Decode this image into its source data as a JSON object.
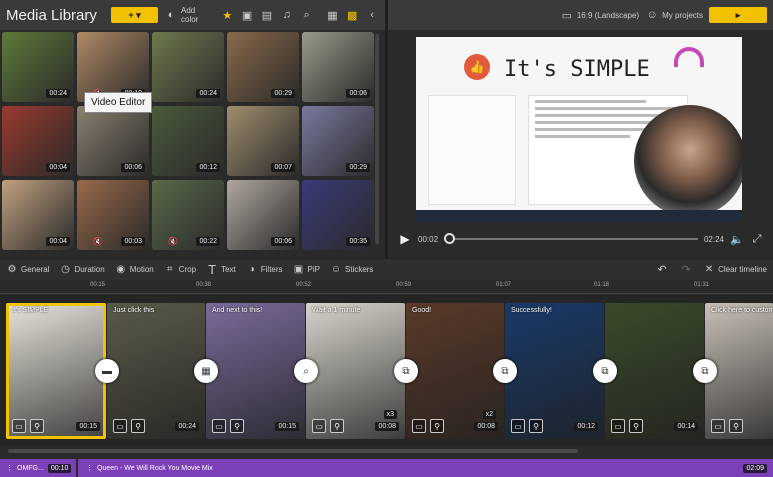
{
  "header": {
    "title": "Media Library",
    "add_color_label": "Add color",
    "aspect_label": "16:9 (Landscape)",
    "my_projects_label": "My projects"
  },
  "tooltip": "Video Editor",
  "media": [
    {
      "duration": "00:24",
      "muted": false,
      "color": "#5f7a3a"
    },
    {
      "duration": "00:10",
      "muted": true,
      "color": "#b08a66"
    },
    {
      "duration": "00:24",
      "muted": false,
      "color": "#6e7a4e"
    },
    {
      "duration": "00:29",
      "muted": false,
      "color": "#8a6a4a"
    },
    {
      "duration": "00:06",
      "muted": false,
      "color": "#9a9a8a"
    },
    {
      "duration": "00:04",
      "muted": false,
      "color": "#9a3a2e"
    },
    {
      "duration": "00:06",
      "muted": false,
      "color": "#8a8070"
    },
    {
      "duration": "00:12",
      "muted": false,
      "color": "#4a5a3a"
    },
    {
      "duration": "00:07",
      "muted": false,
      "color": "#a08e6e"
    },
    {
      "duration": "00:29",
      "muted": false,
      "color": "#7a7aa0"
    },
    {
      "duration": "00:04",
      "muted": false,
      "color": "#c0a080"
    },
    {
      "duration": "00:03",
      "muted": true,
      "color": "#9a6a4a"
    },
    {
      "duration": "00:22",
      "muted": true,
      "color": "#5a6a4a"
    },
    {
      "duration": "00:06",
      "muted": false,
      "color": "#b0a8a0"
    },
    {
      "duration": "00:35",
      "muted": false,
      "color": "#3a3a7a"
    }
  ],
  "preview": {
    "title": "It's SIMPLE",
    "current_time": "00:02",
    "total_time": "02:24",
    "progress": 0.02
  },
  "toolbar": {
    "general": "General",
    "duration": "Duration",
    "motion": "Motion",
    "crop": "Crop",
    "text": "Text",
    "filters": "Filters",
    "pip": "PiP",
    "stickers": "Stickers",
    "clear_timeline": "Clear timeline"
  },
  "ruler": [
    "00:15",
    "00:38",
    "00:52",
    "00:59",
    "01:07",
    "01:18",
    "01:31"
  ],
  "clips": [
    {
      "caption": "It's SIMPLE",
      "duration": "00:15",
      "color": "#e8e4dc"
    },
    {
      "caption": "Just click this",
      "duration": "00:24",
      "color": "#5a5a4a"
    },
    {
      "caption": "And next to this!",
      "duration": "00:15",
      "color": "#7a6a9a"
    },
    {
      "caption": "Wait a 1 minute",
      "duration": "00:08",
      "speed": "x3",
      "color": "#d8d4cc"
    },
    {
      "caption": "Good!",
      "duration": "00:08",
      "speed": "x2",
      "color": "#5a3a2a"
    },
    {
      "caption": "Successfully!",
      "duration": "00:12",
      "color": "#1a3a6a"
    },
    {
      "caption": "",
      "duration": "00:14",
      "color": "#3a4a2a"
    },
    {
      "caption": "Click here to customize",
      "duration": "",
      "color": "#c8c0b8"
    }
  ],
  "audio": {
    "track1_name": "OMFG...",
    "track1_duration": "00:10",
    "track2_name": "Queen - We Will Rock You Movie Mix",
    "track2_duration": "02:09"
  },
  "colors": {
    "accent": "#f2c200",
    "audio": "#7b3fb8"
  }
}
